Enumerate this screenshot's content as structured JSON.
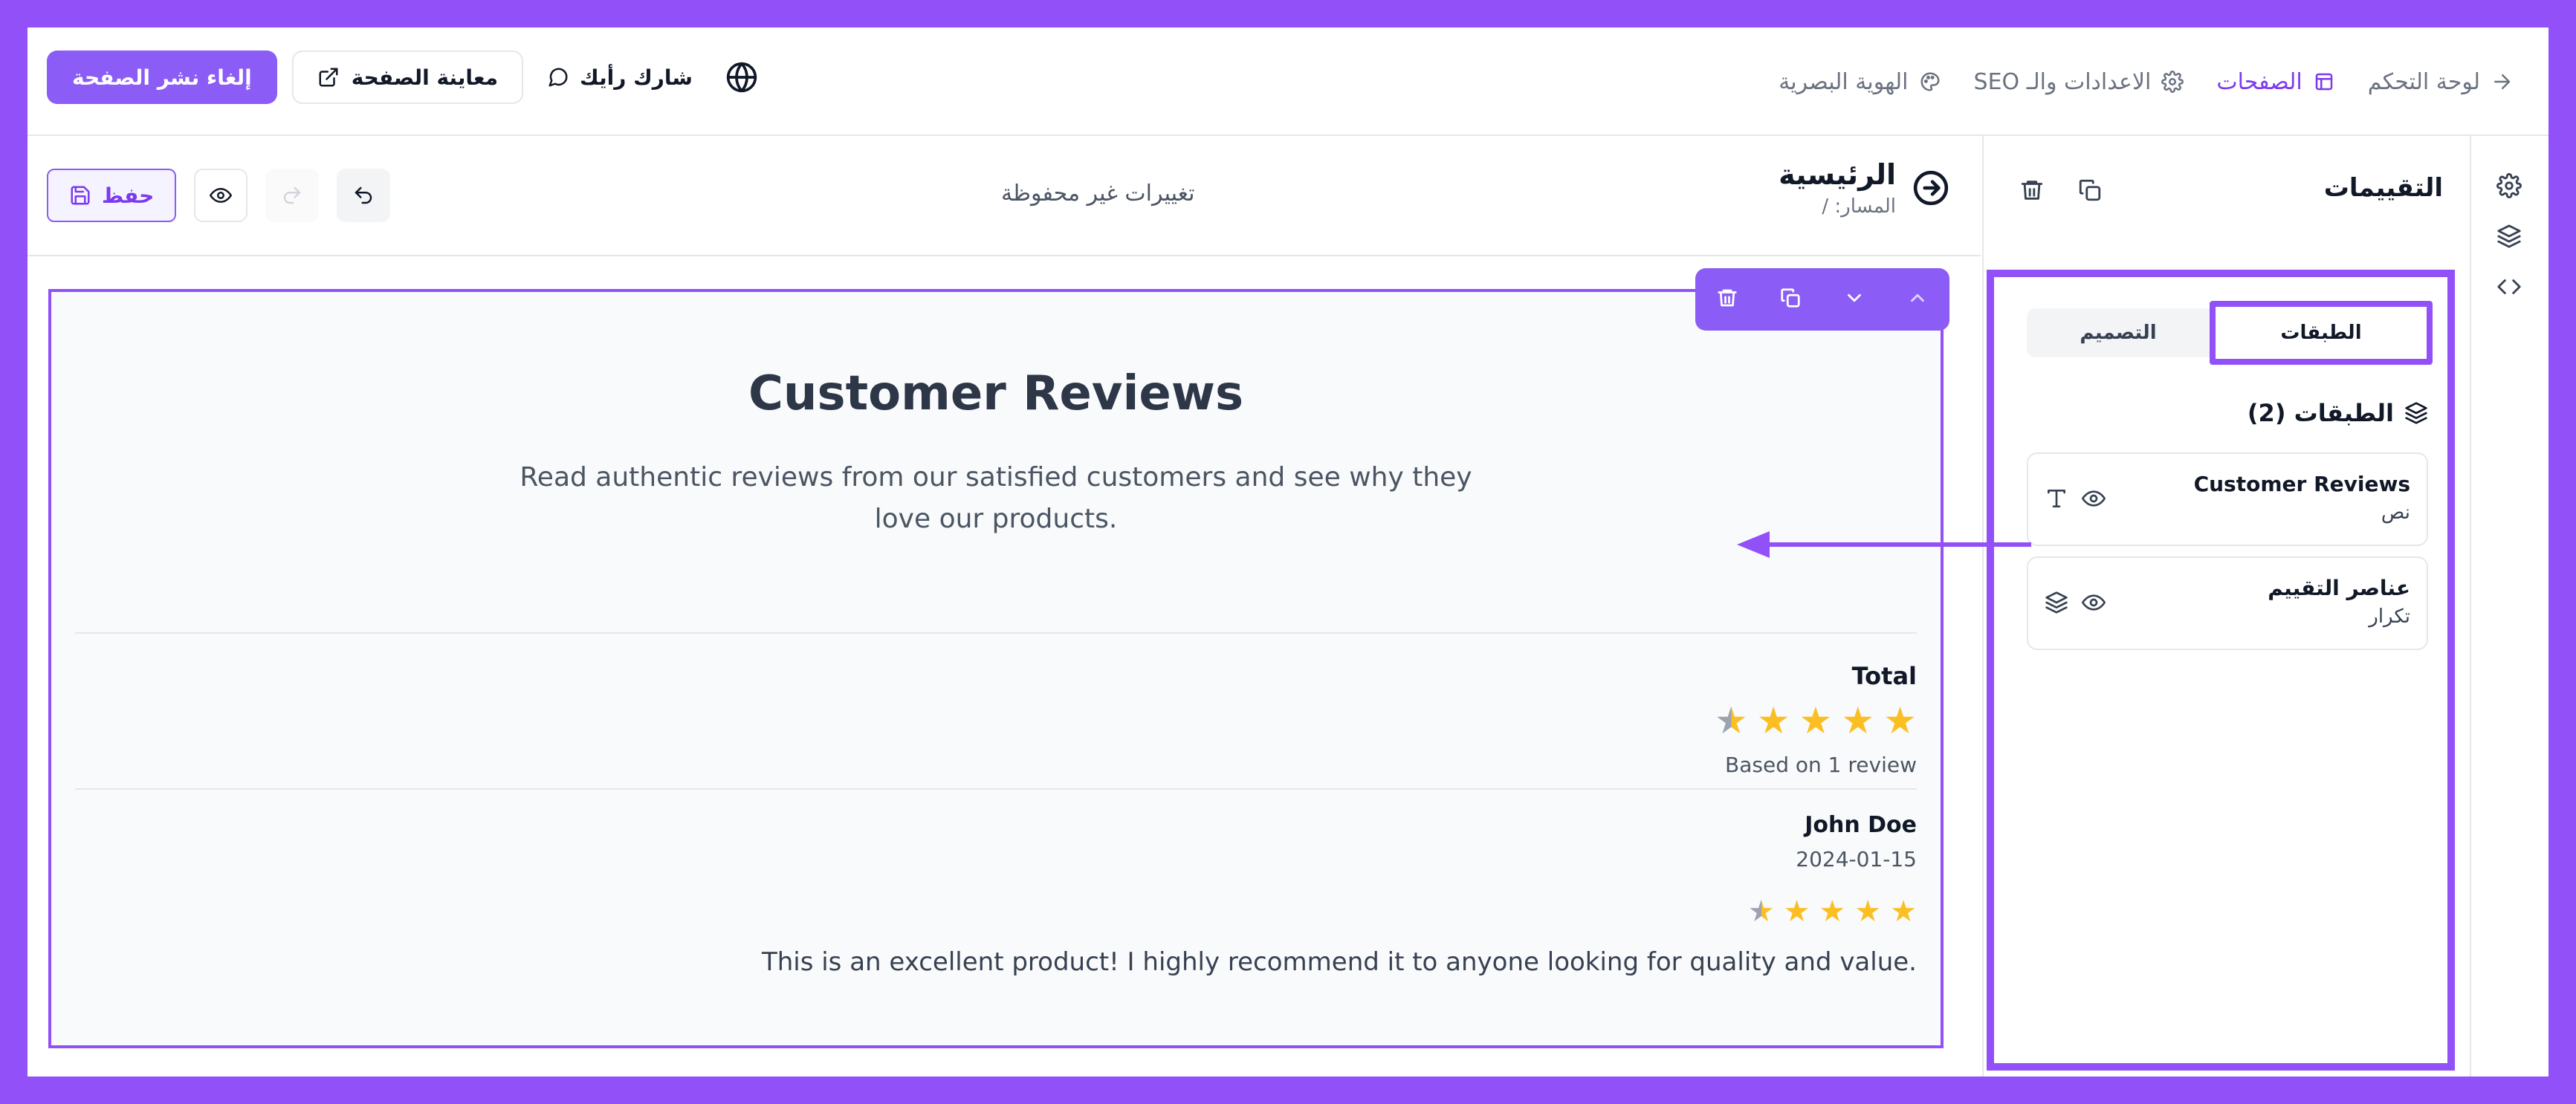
{
  "header": {
    "nav": [
      {
        "label": "لوحة التحكم",
        "icon": "arrow-right-icon",
        "active": false
      },
      {
        "label": "الصفحات",
        "icon": "layout-icon",
        "active": true
      },
      {
        "label": "الاعدادات والـ SEO",
        "icon": "gear-icon",
        "active": false
      },
      {
        "label": "الهوية البصرية",
        "icon": "palette-icon",
        "active": false
      }
    ],
    "unpublish_label": "إلغاء نشر الصفحة",
    "preview_label": "معاينة الصفحة",
    "feedback_label": "شارك رأيك",
    "language_icon": "globe-icon"
  },
  "panel": {
    "title": "التقييمات",
    "tabs": [
      {
        "label": "الطبقات",
        "active": true
      },
      {
        "label": "التصميم",
        "active": false
      }
    ],
    "layers_title": "الطبقات (2)",
    "layers": [
      {
        "name": "Customer Reviews",
        "type": "نص",
        "icon": "text-icon"
      },
      {
        "name": "عناصر التقييم",
        "type": "تكرار",
        "icon": "layers-icon"
      }
    ]
  },
  "editor": {
    "page_name": "الرئيسية",
    "page_path": "المسار: /",
    "status": "تغييرات غير محفوظة",
    "save_label": "حفظ"
  },
  "section": {
    "title": "Customer Reviews",
    "subtitle": "Read authentic reviews from our satisfied customers and see why they love our products.",
    "total_label": "Total",
    "rating": 4.5,
    "based_on": "Based on 1 review",
    "review": {
      "name": "John Doe",
      "date": "2024-01-15",
      "rating": 4.5,
      "text": "This is an excellent product! I highly recommend it to anyone looking for quality and value."
    }
  },
  "colors": {
    "accent": "#8b5cf6",
    "highlight": "#9150f8",
    "star": "#fbbf24"
  }
}
